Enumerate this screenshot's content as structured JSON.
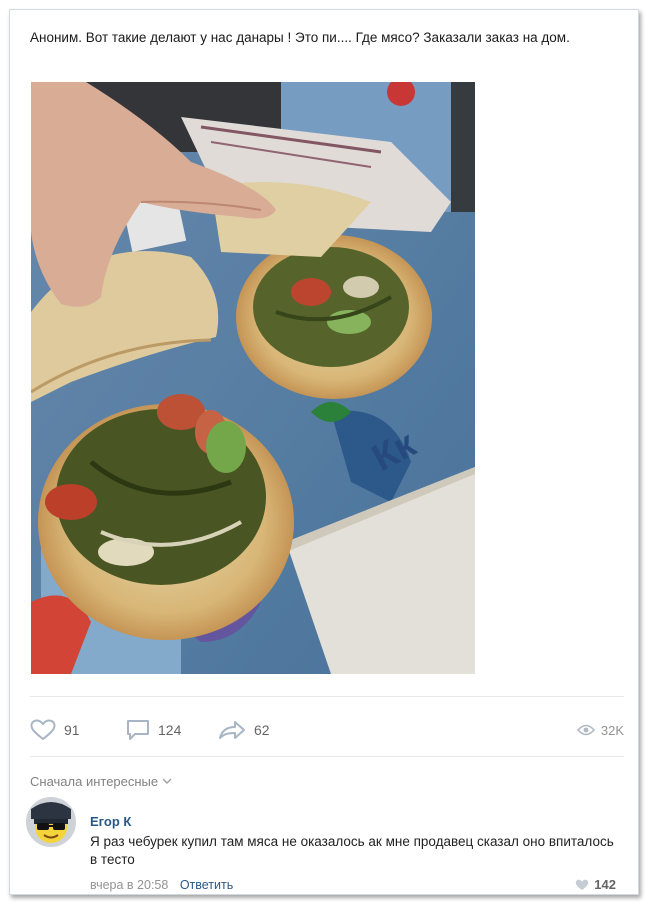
{
  "post": {
    "text": "Аноним. Вот такие делают у нас данары ! Это пи.... Где мясо? Заказали заказ на дом.",
    "photo_icon": "photo-shawarma"
  },
  "actions": {
    "likes": "91",
    "comments": "124",
    "shares": "62",
    "views": "32K"
  },
  "comments_section": {
    "sort_label": "Сначала интересные",
    "items": [
      {
        "author": "Егор К",
        "text": "Я раз чебурек купил там мяса не оказалось ак мне продавец сказал оно впиталось в тесто",
        "time": "вчера в 20:58",
        "reply_label": "Ответить",
        "likes": "142"
      }
    ]
  },
  "colors": {
    "link": "#2a5885",
    "muted": "#939393",
    "accent_icon": "#a8b5c4"
  }
}
